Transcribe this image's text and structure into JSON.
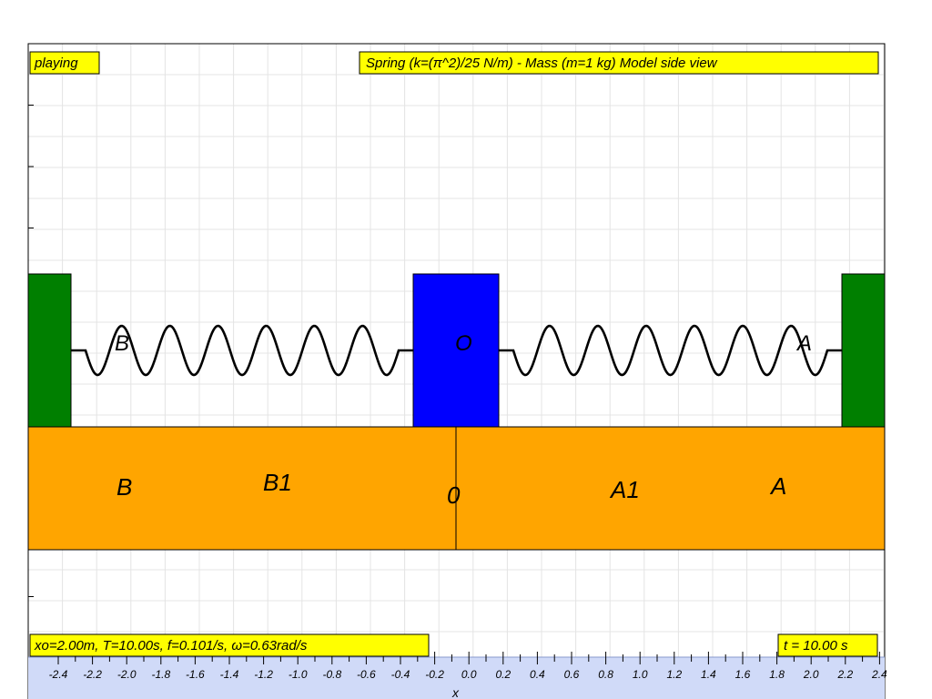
{
  "status": {
    "label": "playing"
  },
  "title": {
    "text": "Spring (k=(π^2)/25 N/m) - Mass (m=1 kg) Model side view"
  },
  "params": {
    "text": "xo=2.00m, T=10.00s, f=0.101/s, ω=0.63rad/s"
  },
  "time": {
    "text": "t = 10.00 s"
  },
  "axis": {
    "label": "x",
    "ticks": [
      "-2.4",
      "-2.2",
      "-2.0",
      "-1.8",
      "-1.6",
      "-1.4",
      "-1.2",
      "-1.0",
      "-0.8",
      "-0.6",
      "-0.4",
      "-0.2",
      "0.0",
      "0.2",
      "0.4",
      "0.6",
      "0.8",
      "1.0",
      "1.2",
      "1.4",
      "1.6",
      "1.8",
      "2.0",
      "2.2",
      "2.4"
    ]
  },
  "markers": {
    "spring_left": "B",
    "spring_mass": "O",
    "spring_right": "A",
    "floor_B": "B",
    "floor_B1": "B1",
    "floor_0": "0",
    "floor_A1": "A1",
    "floor_A": "A"
  },
  "colors": {
    "wall": "#007f00",
    "mass": "#0000ff",
    "floor": "#ffa500",
    "label_bg": "#ffff00",
    "axis_bg": "#d0daf8",
    "spring": "#000000"
  }
}
